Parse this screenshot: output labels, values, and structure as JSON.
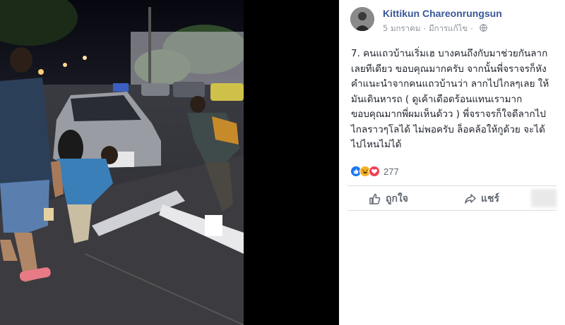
{
  "post": {
    "author": "Kittikun Chareonrungsun",
    "date": "5 มกราคม",
    "separator": "·",
    "edited": "มีการแก้ไข",
    "text": "7. คนแถวบ้านเริ่มเฮ บางคนถึงกับมาช่วยกันลากเลยทีเดียว ขอบคุณมากครับ จากนั้นพี่จราจรก็หังคำแนะนำจากคนแถวบ้านว่า ลากไปไกลๆเลย ให้ มันเดินหารถ ( ดูเค้าเดือดร้อนแทนเรามาก ขอบคุณมากพี่ผมเห็นด้วว ) พี่จราจรก็ใจดีลากไปไกลราวๆโลได้ ไม่พอครับ ล็อคล้อให้กูด้วย จะได้ไปไหนไม่ได้",
    "reaction_count": "277",
    "reaction_icons": [
      "like-icon",
      "haha-icon",
      "love-icon"
    ]
  },
  "actions": {
    "like_label": "ถูกใจ",
    "share_label": "แชร์"
  },
  "colors": {
    "author": "#385898",
    "like_blue": "#1877f2",
    "love_red": "#f33e58",
    "haha_yellow": "#f7b125"
  }
}
